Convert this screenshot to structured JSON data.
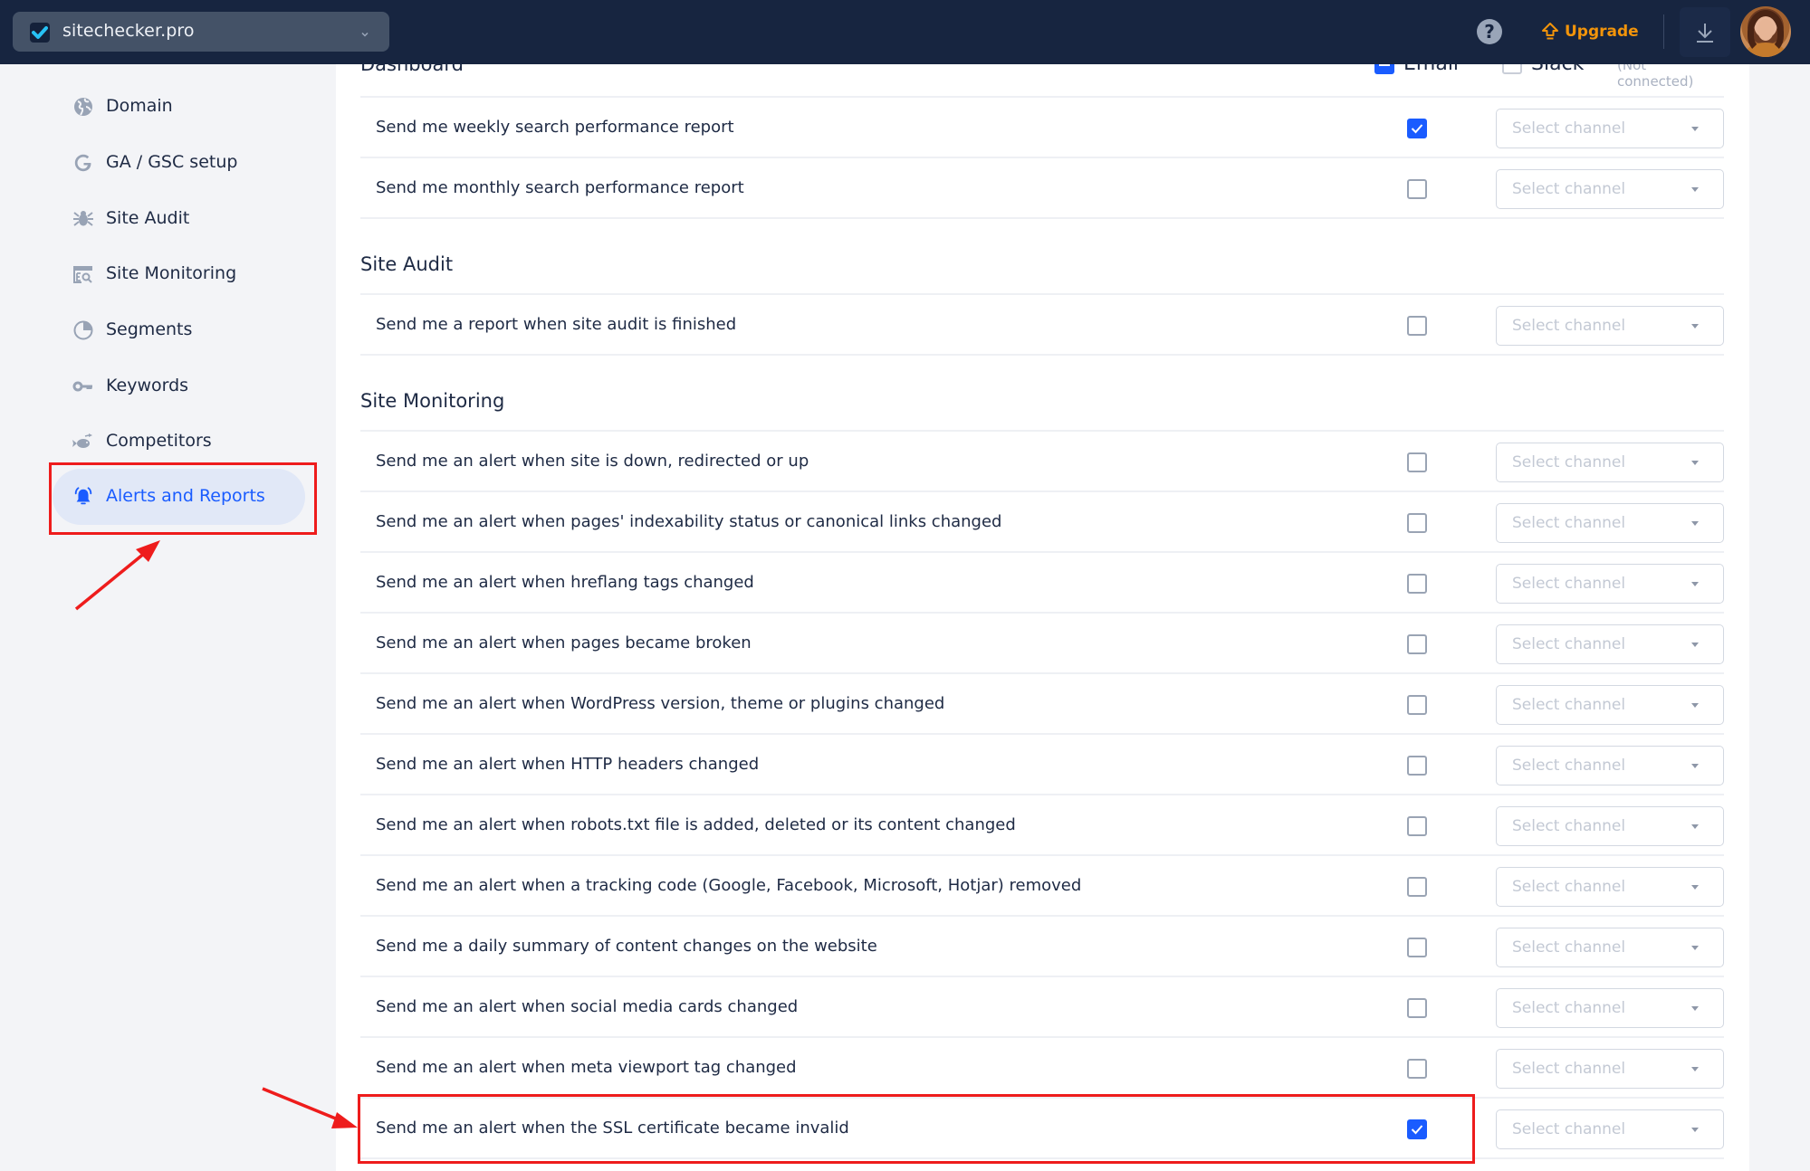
{
  "topbar": {
    "site_name": "sitechecker.pro",
    "help_label": "?",
    "upgrade_label": "Upgrade",
    "upgrade_color": "#f2940a",
    "icons": {
      "logo": "check-logo-icon",
      "chevron": "chevron-down-icon",
      "help": "question-circle-icon",
      "upgrade": "upgrade-arrow-icon",
      "download": "download-icon",
      "avatar": "user-avatar"
    }
  },
  "sidebar": {
    "items": [
      {
        "label": "Domain",
        "icon": "globe-icon",
        "active": false
      },
      {
        "label": "GA / GSC setup",
        "icon": "google-icon",
        "active": false
      },
      {
        "label": "Site Audit",
        "icon": "spider-icon",
        "active": false
      },
      {
        "label": "Site Monitoring",
        "icon": "monitoring-icon",
        "active": false
      },
      {
        "label": "Segments",
        "icon": "pie-chart-icon",
        "active": false
      },
      {
        "label": "Keywords",
        "icon": "key-icon",
        "active": false
      },
      {
        "label": "Competitors",
        "icon": "fish-icon",
        "active": false
      },
      {
        "label": "Alerts and Reports",
        "icon": "bell-icon",
        "active": true
      }
    ],
    "active_color": "#1a5cff"
  },
  "main": {
    "columns": {
      "email_label": "Email",
      "email_state": "indeterminate",
      "slack_label": "Slack",
      "slack_checked": false,
      "slack_note": "(Not connected)"
    },
    "sections": [
      {
        "title": "Dashboard",
        "rows": [
          {
            "label": "Send me weekly search performance report",
            "email": true,
            "channel_placeholder": "Select channel"
          },
          {
            "label": "Send me monthly search performance report",
            "email": false,
            "channel_placeholder": "Select channel"
          }
        ]
      },
      {
        "title": "Site Audit",
        "rows": [
          {
            "label": "Send me a report when site audit is finished",
            "email": false,
            "channel_placeholder": "Select channel"
          }
        ]
      },
      {
        "title": "Site Monitoring",
        "rows": [
          {
            "label": "Send me an alert when site is down, redirected or up",
            "email": false,
            "channel_placeholder": "Select channel"
          },
          {
            "label": "Send me an alert when pages' indexability status or canonical links changed",
            "email": false,
            "channel_placeholder": "Select channel"
          },
          {
            "label": "Send me an alert when hreflang tags changed",
            "email": false,
            "channel_placeholder": "Select channel"
          },
          {
            "label": "Send me an alert when pages became broken",
            "email": false,
            "channel_placeholder": "Select channel"
          },
          {
            "label": "Send me an alert when WordPress version, theme or plugins changed",
            "email": false,
            "channel_placeholder": "Select channel"
          },
          {
            "label": "Send me an alert when HTTP headers changed",
            "email": false,
            "channel_placeholder": "Select channel"
          },
          {
            "label": "Send me an alert when robots.txt file is added, deleted or its content changed",
            "email": false,
            "channel_placeholder": "Select channel"
          },
          {
            "label": "Send me an alert when a tracking code (Google, Facebook, Microsoft, Hotjar) removed",
            "email": false,
            "channel_placeholder": "Select channel"
          },
          {
            "label": "Send me a daily summary of content changes on the website",
            "email": false,
            "channel_placeholder": "Select channel"
          },
          {
            "label": "Send me an alert when social media cards changed",
            "email": false,
            "channel_placeholder": "Select channel"
          },
          {
            "label": "Send me an alert when meta viewport tag changed",
            "email": false,
            "channel_placeholder": "Select channel"
          },
          {
            "label": "Send me an alert when the SSL certificate became invalid",
            "email": true,
            "channel_placeholder": "Select channel"
          }
        ]
      }
    ]
  },
  "annotations": {
    "color": "#ee1c1c",
    "highlighted": [
      "sidebar: Alerts and Reports",
      "row: Send me an alert when the SSL certificate became invalid"
    ]
  }
}
